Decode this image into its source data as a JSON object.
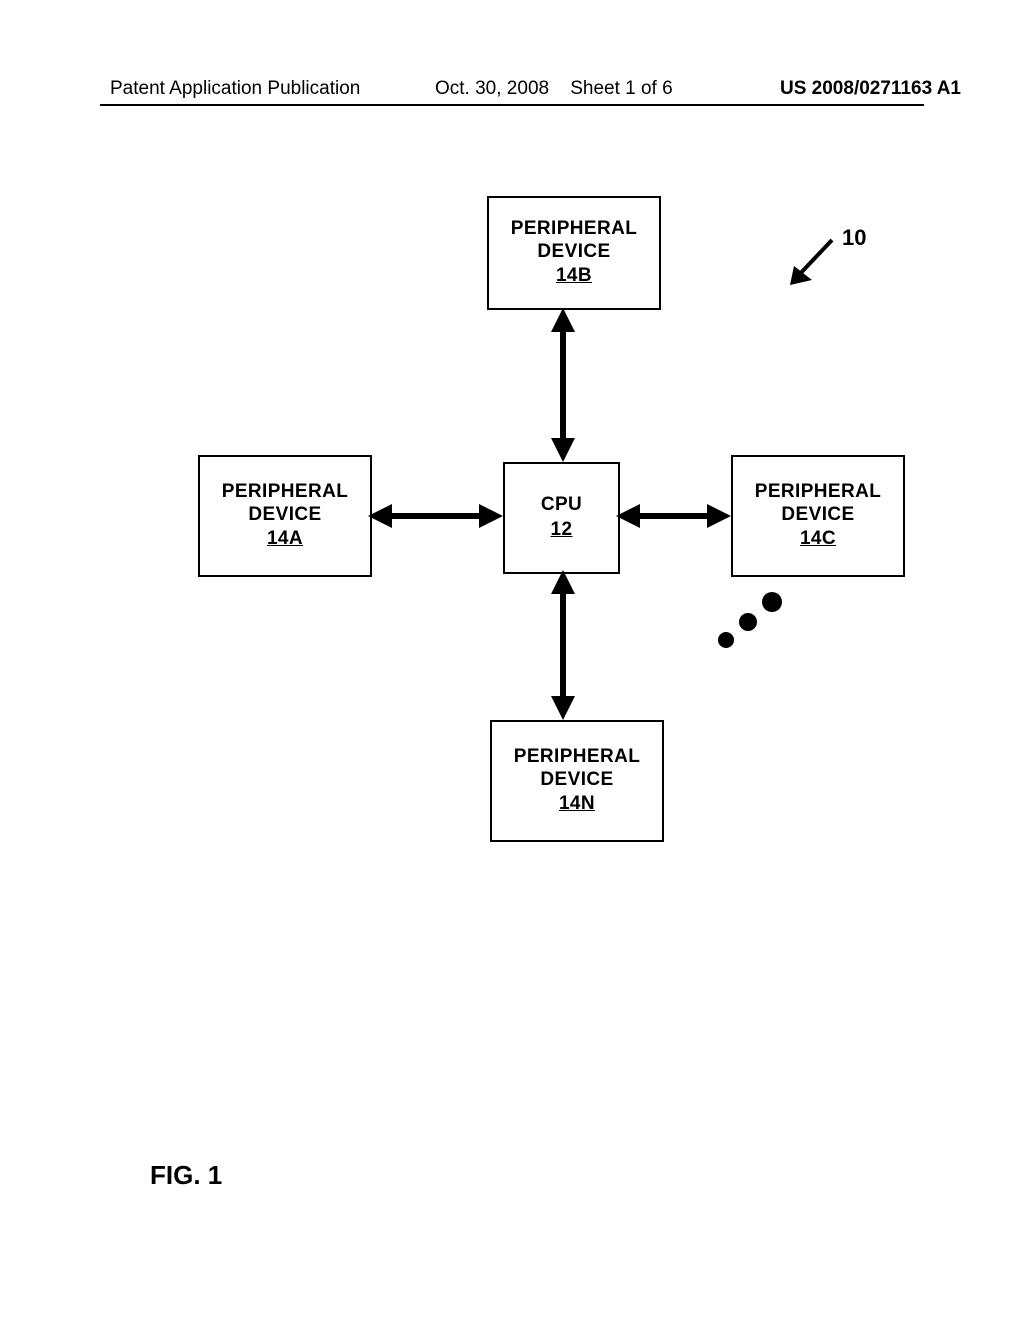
{
  "header": {
    "left": "Patent Application Publication",
    "center_date": "Oct. 30, 2008",
    "center_sheet": "Sheet 1 of 6",
    "right": "US 2008/0271163 A1"
  },
  "diagram": {
    "system_ref": "10",
    "cpu": {
      "title": "CPU",
      "ref": "12"
    },
    "peripheral_a": {
      "line1": "PERIPHERAL",
      "line2": "DEVICE",
      "ref": "14A"
    },
    "peripheral_b": {
      "line1": "PERIPHERAL",
      "line2": "DEVICE",
      "ref": "14B"
    },
    "peripheral_c": {
      "line1": "PERIPHERAL",
      "line2": "DEVICE",
      "ref": "14C"
    },
    "peripheral_n": {
      "line1": "PERIPHERAL",
      "line2": "DEVICE",
      "ref": "14N"
    }
  },
  "figure_label": "FIG. 1"
}
